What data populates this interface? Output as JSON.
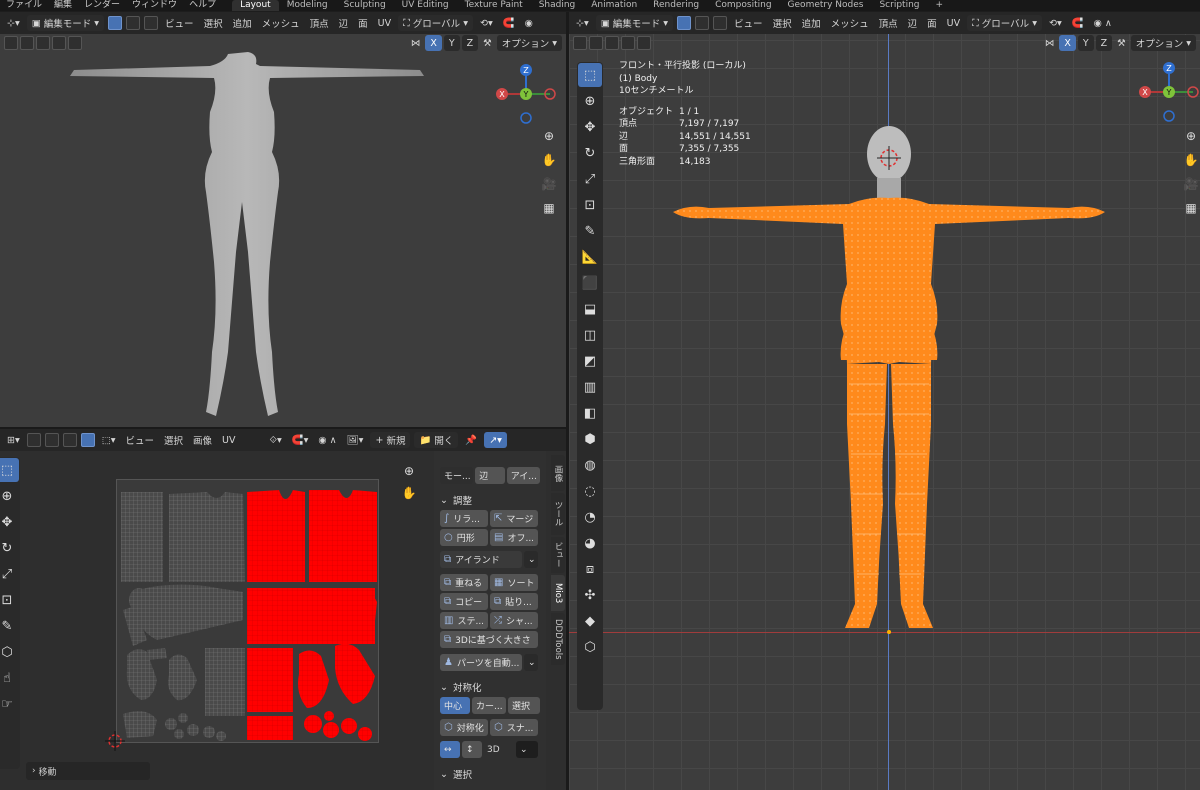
{
  "menubar": {
    "menus": [
      "ファイル",
      "編集",
      "レンダー",
      "ウィンドウ",
      "ヘルプ"
    ],
    "workspaces": [
      "Layout",
      "Modeling",
      "Sculpting",
      "UV Editing",
      "Texture Paint",
      "Shading",
      "Animation",
      "Rendering",
      "Compositing",
      "Geometry Nodes",
      "Scripting"
    ],
    "add_tab": "+"
  },
  "viewport_left": {
    "mode": "編集モード",
    "menus": [
      "ビュー",
      "選択",
      "追加",
      "メッシュ",
      "頂点",
      "辺",
      "面",
      "UV"
    ],
    "transform": "グローバル",
    "axes": [
      "X",
      "Y",
      "Z"
    ],
    "options": "オプション",
    "gizmo": {
      "z": "Z",
      "y": "Y",
      "x": "X"
    }
  },
  "viewport_right": {
    "mode": "編集モード",
    "menus": [
      "ビュー",
      "選択",
      "追加",
      "メッシュ",
      "頂点",
      "辺",
      "面",
      "UV"
    ],
    "transform": "グローバル",
    "axes": [
      "X",
      "Y",
      "Z"
    ],
    "options": "オプション",
    "gizmo": {
      "z": "Z",
      "y": "Y",
      "x": "X"
    },
    "overlay": {
      "view_name": "フロント・平行投影 (ローカル)",
      "object_name": "(1) Body",
      "scale": "10センチメートル",
      "stats": [
        {
          "label": "オブジェクト",
          "value": "1 / 1"
        },
        {
          "label": "頂点",
          "value": "7,197 / 7,197"
        },
        {
          "label": "辺",
          "value": "14,551 / 14,551"
        },
        {
          "label": "面",
          "value": "7,355 / 7,355"
        },
        {
          "label": "三角形面",
          "value": "14,183"
        }
      ]
    }
  },
  "uv_editor": {
    "menus": [
      "ビュー",
      "選択",
      "画像",
      "UV"
    ],
    "new_label": "新規",
    "open_label": "開く",
    "last_op": "移動",
    "npanel": {
      "top_row": [
        "モー...",
        "辺",
        "アイ..."
      ],
      "section_adjust": "調整",
      "adjust_rows": [
        [
          "リラ...",
          "マージ"
        ],
        [
          "円形",
          "オフ..."
        ]
      ],
      "island_dropdown": "アイランド",
      "island_rows": [
        [
          "重ねる",
          "ソート"
        ],
        [
          "コピー",
          "貼り..."
        ],
        [
          "ステ...",
          "シャ..."
        ]
      ],
      "scale_button": "3Dに基づく大きさ",
      "parts_dropdown": "パーツを自動...",
      "section_symmetry": "対称化",
      "symmetry_row": [
        "中心",
        "カー...",
        "選択"
      ],
      "symmetry_row2": [
        "対称化",
        "スナ..."
      ],
      "dim_label": "3D",
      "section_select": "選択"
    },
    "vtabs": [
      "画像",
      "ツール",
      "ビュー",
      "Mio3",
      "DDDTools"
    ]
  }
}
